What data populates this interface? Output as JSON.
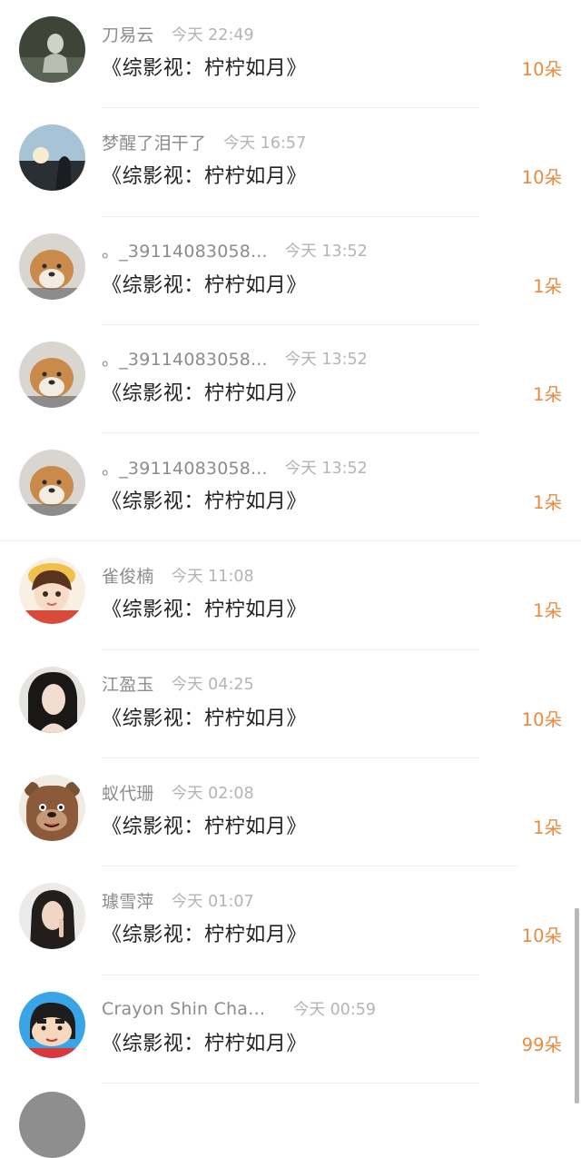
{
  "list": {
    "items": [
      {
        "name": "刀易云",
        "time": "今天 22:49",
        "title": "《综影视：柠柠如月》",
        "gift": "10朵"
      },
      {
        "name": "梦醒了泪干了",
        "time": "今天 16:57",
        "title": "《综影视：柠柠如月》",
        "gift": "10朵"
      },
      {
        "name": "。_39114083058...",
        "time": "今天 13:52",
        "title": "《综影视：柠柠如月》",
        "gift": "1朵"
      },
      {
        "name": "。_39114083058...",
        "time": "今天 13:52",
        "title": "《综影视：柠柠如月》",
        "gift": "1朵"
      },
      {
        "name": "。_39114083058...",
        "time": "今天 13:52",
        "title": "《综影视：柠柠如月》",
        "gift": "1朵"
      },
      {
        "name": "雀俊楠",
        "time": "今天 11:08",
        "title": "《综影视：柠柠如月》",
        "gift": "1朵"
      },
      {
        "name": "江盈玉",
        "time": "今天 04:25",
        "title": "《综影视：柠柠如月》",
        "gift": "10朵"
      },
      {
        "name": "蚁代珊",
        "time": "今天 02:08",
        "title": "《综影视：柠柠如月》",
        "gift": "1朵"
      },
      {
        "name": "璩雪萍",
        "time": "今天 01:07",
        "title": "《综影视：柠柠如月》",
        "gift": "10朵"
      },
      {
        "name": "Crayon Shin Chan...",
        "time": "今天 00:59",
        "title": "《综影视：柠柠如月》",
        "gift": "99朵"
      }
    ]
  },
  "colors": {
    "gift": "#ea8a3e",
    "name": "#8c8c8c",
    "time": "#b4b4b4",
    "title": "#222222"
  }
}
